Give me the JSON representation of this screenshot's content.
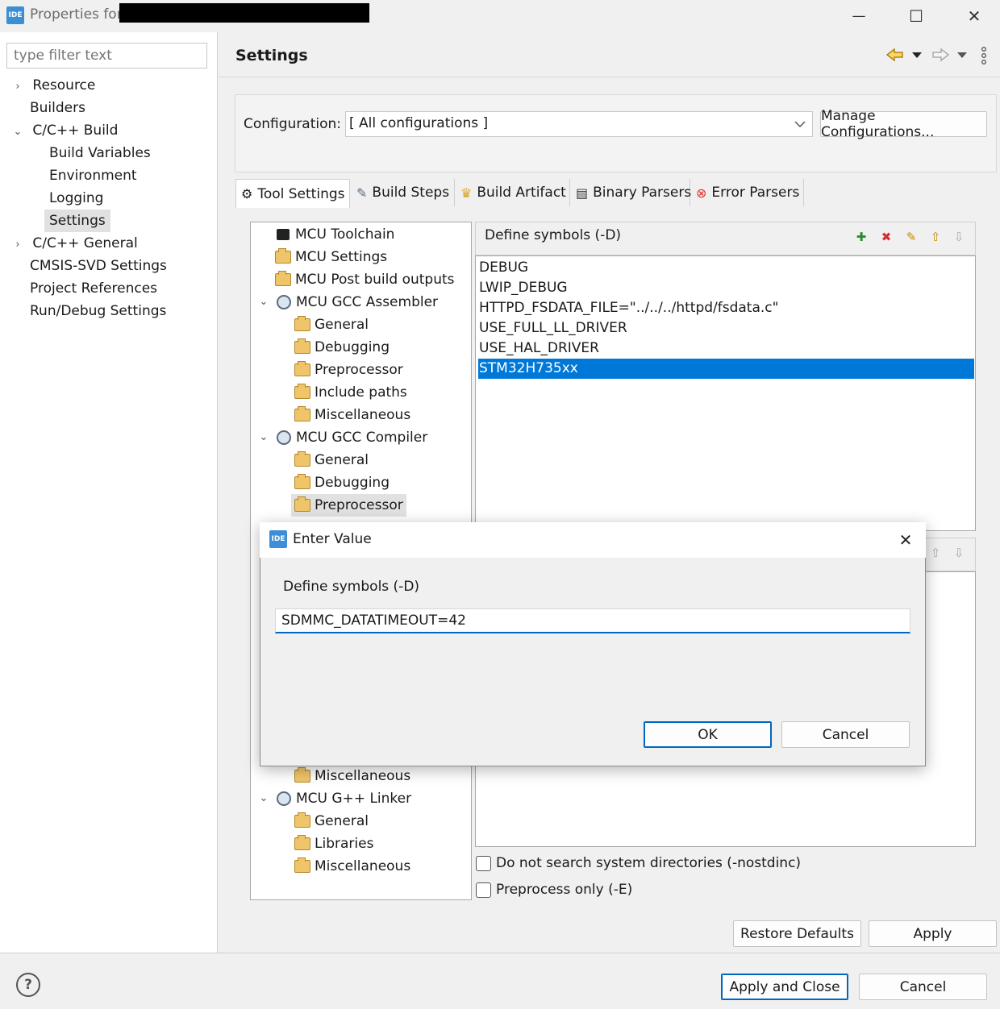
{
  "window": {
    "badge": "IDE",
    "title": "Properties for",
    "minimize_glyph": "—",
    "maximize_glyph": "☐",
    "close_glyph": "✕"
  },
  "filter": {
    "placeholder": "type filter text"
  },
  "nav": {
    "items": [
      {
        "label": "Resource",
        "expander": "›"
      },
      {
        "label": "Builders",
        "expander": ""
      },
      {
        "label": "C/C++ Build",
        "expander": "⌄"
      },
      {
        "label": "Build Variables",
        "expander": ""
      },
      {
        "label": "Environment",
        "expander": ""
      },
      {
        "label": "Logging",
        "expander": ""
      },
      {
        "label": "Settings",
        "expander": ""
      },
      {
        "label": "C/C++ General",
        "expander": "›"
      },
      {
        "label": "CMSIS-SVD Settings",
        "expander": ""
      },
      {
        "label": "Project References",
        "expander": ""
      },
      {
        "label": "Run/Debug Settings",
        "expander": ""
      }
    ]
  },
  "header": {
    "title": "Settings"
  },
  "config": {
    "label": "Configuration:",
    "value": "[ All configurations ]",
    "manage_label": "Manage Configurations..."
  },
  "tabs": [
    {
      "label": "Tool Settings",
      "icon": "tool-settings-icon"
    },
    {
      "label": "Build Steps",
      "icon": "build-steps-icon"
    },
    {
      "label": "Build Artifact",
      "icon": "trophy-icon"
    },
    {
      "label": "Binary Parsers",
      "icon": "binary-icon"
    },
    {
      "label": "Error Parsers",
      "icon": "error-icon"
    }
  ],
  "tree": {
    "items": [
      {
        "label": "MCU Toolchain"
      },
      {
        "label": "MCU Settings"
      },
      {
        "label": "MCU Post build outputs"
      },
      {
        "label": "MCU GCC Assembler"
      },
      {
        "label": "General"
      },
      {
        "label": "Debugging"
      },
      {
        "label": "Preprocessor"
      },
      {
        "label": "Include paths"
      },
      {
        "label": "Miscellaneous"
      },
      {
        "label": "MCU GCC Compiler"
      },
      {
        "label": "General"
      },
      {
        "label": "Debugging"
      },
      {
        "label": "Preprocessor"
      },
      {
        "label": "Miscellaneous"
      },
      {
        "label": "MCU G++ Linker"
      },
      {
        "label": "General"
      },
      {
        "label": "Libraries"
      },
      {
        "label": "Miscellaneous"
      }
    ]
  },
  "symbols": {
    "title": "Define symbols (-D)",
    "items": [
      "DEBUG",
      "LWIP_DEBUG",
      "HTTPD_FSDATA_FILE=\"../../../httpd/fsdata.c\"",
      "USE_FULL_LL_DRIVER",
      "USE_HAL_DRIVER",
      "STM32H735xx"
    ],
    "selected_index": 5
  },
  "options": {
    "nostdinc": "Do not search system directories (-nostdinc)",
    "preprocess_only": "Preprocess only (-E)"
  },
  "buttons": {
    "restore_defaults": "Restore Defaults",
    "apply": "Apply",
    "apply_close": "Apply and Close",
    "cancel": "Cancel"
  },
  "help": {
    "glyph": "?"
  },
  "dialog": {
    "badge": "IDE",
    "title": "Enter Value",
    "close_glyph": "✕",
    "label": "Define symbols (-D)",
    "value": "SDMMC_DATATIMEOUT=42",
    "ok": "OK",
    "cancel": "Cancel"
  },
  "colors": {
    "selection": "#0078d7",
    "accent": "#0067c0",
    "ide_badge": "#3c8fd6"
  }
}
